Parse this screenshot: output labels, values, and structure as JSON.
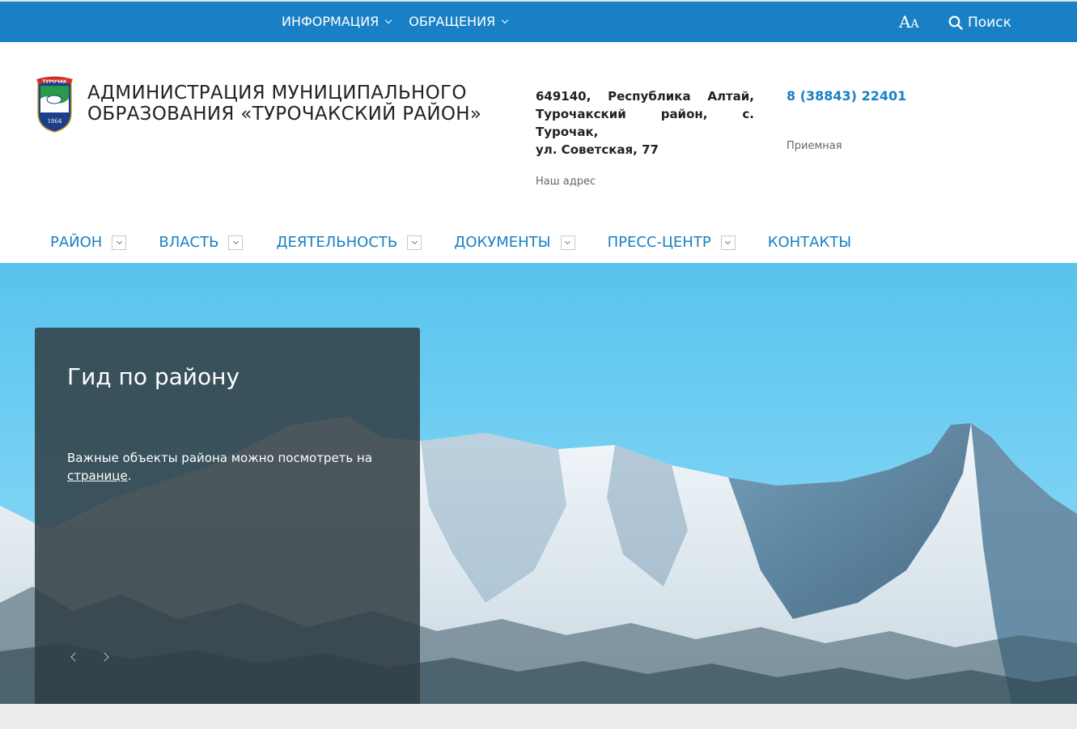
{
  "topbar": {
    "menu": [
      {
        "label": "ИНФОРМАЦИЯ"
      },
      {
        "label": "ОБРАЩЕНИЯ"
      }
    ],
    "font_size_big": "A",
    "font_size_small": "A",
    "search_label": "Поиск",
    "bg_color": "#1a80c6"
  },
  "header": {
    "logo_text": "ТУРОЧАК",
    "logo_year": "1864",
    "title_line1": "АДМИНИСТРАЦИЯ МУНИЦИПАЛЬНОГО",
    "title_line2": "ОБРАЗОВАНИЯ «ТУРОЧАКСКИЙ РАЙОН»",
    "address_line1": "649140, Республика Алтай,",
    "address_line2": "Турочакский район, с. Турочак,",
    "address_line3": "ул. Советская, 77",
    "address_label": "Наш адрес",
    "phone": "8 (38843) 22401",
    "phone_label": "Приемная"
  },
  "nav": {
    "items": [
      {
        "label": "РАЙОН",
        "has_dropdown": true
      },
      {
        "label": "ВЛАСТЬ",
        "has_dropdown": true
      },
      {
        "label": "ДЕЯТЕЛЬНОСТЬ",
        "has_dropdown": true
      },
      {
        "label": "ДОКУМЕНТЫ",
        "has_dropdown": true
      },
      {
        "label": "ПРЕСС-ЦЕНТР",
        "has_dropdown": true
      },
      {
        "label": "КОНТАКТЫ",
        "has_dropdown": false
      }
    ]
  },
  "hero": {
    "card_title": "Гид по району",
    "card_text": "Важные объекты района можно посмотреть на ",
    "card_link": "странице",
    "card_text_end": "."
  }
}
